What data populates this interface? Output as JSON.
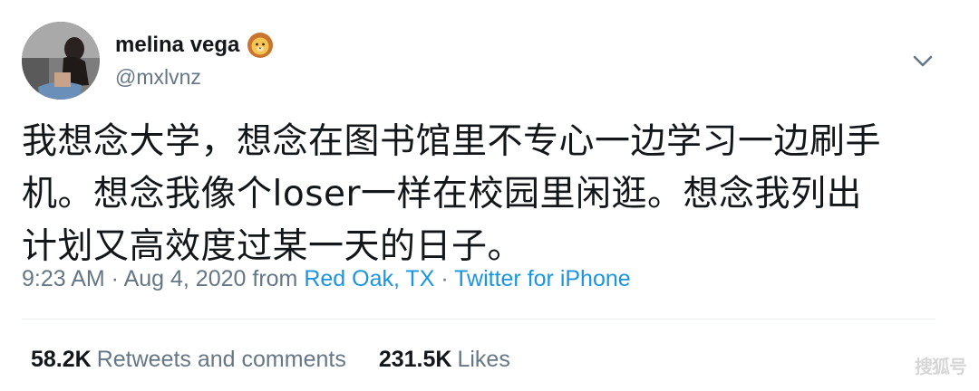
{
  "colors": {
    "text": "#14171a",
    "secondary": "#657786",
    "link": "#1b95e0",
    "divider": "#e6ecf0"
  },
  "user": {
    "display_name": "melina vega",
    "handle": "@mxlvnz",
    "name_emoji_icon": "lion-face-icon",
    "avatar_icon": "profile-photo"
  },
  "tweet": {
    "text_lines": [
      "我想念大学，想念在图书馆里不专心一边学习一边刷手",
      "机。想念我像个loser一样在校园里闲逛。想念我列出",
      "计划又高效度过某一天的日子。"
    ]
  },
  "meta": {
    "time": "9:23 AM",
    "separator": " · ",
    "date": "Aug 4, 2020",
    "from_label": " from ",
    "location": "Red Oak, TX",
    "source": "Twitter for iPhone"
  },
  "stats": {
    "retweets_count": "58.2K",
    "retweets_label": "Retweets and comments",
    "likes_count": "231.5K",
    "likes_label": "Likes"
  },
  "menu": {
    "caret_icon": "chevron-down-icon"
  },
  "watermark": {
    "text": "搜狐号"
  }
}
